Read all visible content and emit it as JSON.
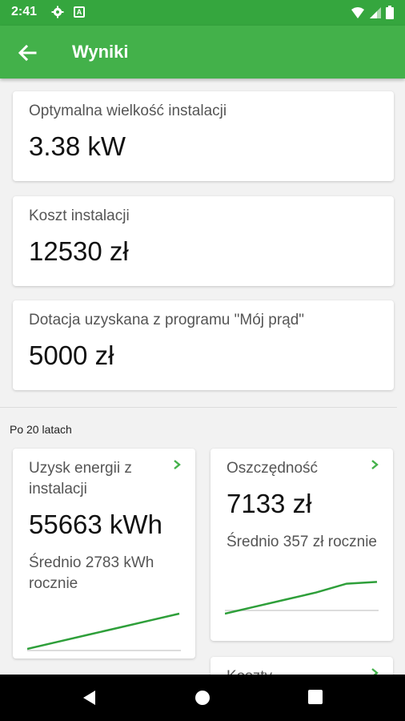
{
  "status_bar": {
    "time": "2:41",
    "a_glyph": "A",
    "icons": [
      "gear-icon",
      "a-icon",
      "wifi-icon",
      "signal-icon",
      "battery-icon"
    ]
  },
  "app_bar": {
    "title": "Wyniki",
    "back_icon": "arrow-left-icon"
  },
  "results": [
    {
      "label": "Optymalna wielkość instalacji",
      "value": "3.38 kW"
    },
    {
      "label": "Koszt instalacji",
      "value": "12530 zł"
    },
    {
      "label": "Dotacja uzyskana z programu \"Mój prąd\"",
      "value": "5000 zł"
    }
  ],
  "section_title": "Po 20 latach",
  "summary_cards": [
    {
      "label": "Uzysk energii z instalacji",
      "value": "55663 kWh",
      "sub": "Średnio 2783 kWh rocznie",
      "trend": [
        0.0,
        0.2,
        0.4,
        0.6,
        0.8,
        1.0
      ]
    },
    {
      "label": "Oszczędność",
      "value": "7133 zł",
      "sub": "Średnio 357 zł rocznie",
      "trend": [
        0.0,
        0.2,
        0.4,
        0.6,
        0.85,
        0.9
      ]
    },
    {
      "label": "Koszty"
    }
  ],
  "colors": {
    "accent": "#43b14a",
    "status_bar": "#35a63e",
    "line": "#2e9f3a"
  },
  "nav_bar": {
    "icons": [
      "back-triangle-icon",
      "home-circle-icon",
      "recents-square-icon"
    ]
  }
}
